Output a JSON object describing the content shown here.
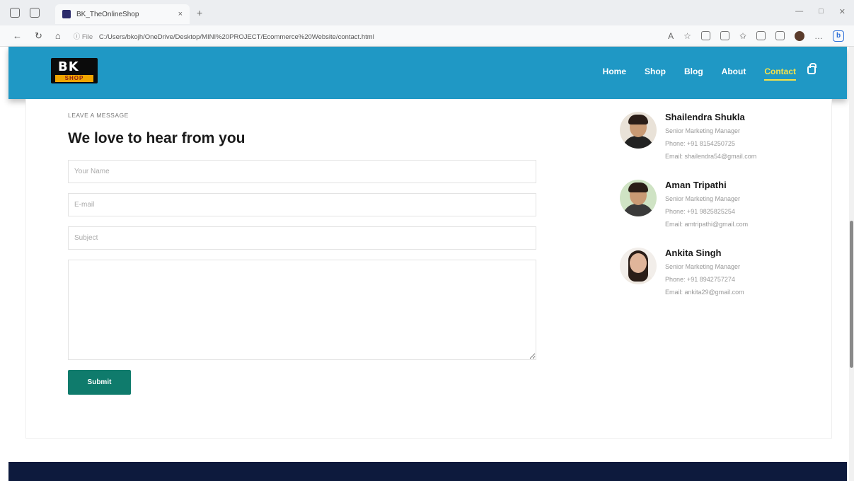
{
  "browser": {
    "tab_title": "BK_TheOnlineShop",
    "tab_close": "×",
    "new_tab": "+",
    "url_info": "ⓘ File",
    "url": "C:/Users/bkojh/OneDrive/Desktop/MINI%20PROJECT/Ecommerce%20Website/contact.html"
  },
  "site": {
    "logo_top": "BK",
    "logo_bottom": "SHOP",
    "nav": [
      "Home",
      "Shop",
      "Blog",
      "About",
      "Contact"
    ],
    "active_nav": "Contact"
  },
  "form": {
    "eyebrow": "LEAVE A MESSAGE",
    "heading": "We love to hear from you",
    "name_placeholder": "Your Name",
    "email_placeholder": "E-mail",
    "subject_placeholder": "Subject",
    "submit_label": "Submit"
  },
  "contacts": [
    {
      "name": "Shailendra Shukla",
      "role": "Senior Marketing Manager",
      "phone": "Phone: +91 8154250725",
      "email": "Email: shailendra54@gmail.com"
    },
    {
      "name": "Aman Tripathi",
      "role": "Senior Marketing Manager",
      "phone": "Phone: +91 9825825254",
      "email": "Email: amtripathi@gmail.com"
    },
    {
      "name": "Ankita Singh",
      "role": "Senior Marketing Manager",
      "phone": "Phone: +91 8942757274",
      "email": "Email: ankita29@gmail.com"
    }
  ]
}
